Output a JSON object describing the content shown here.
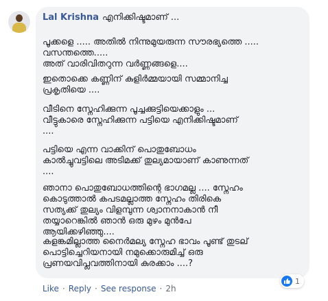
{
  "comment": {
    "author": "Lal Krishna",
    "first_line": "എനിക്കിഷ്ടമാണ് ...",
    "paragraphs": [
      [
        "പൂക്കളെ ..... അതിൽ നിന്നുമുയരുന്ന സൗരഭ്യത്തെ .....",
        "വസന്തത്തെ.....",
        "അത് വാരിവിതറുന്ന വർണ്ണങ്ങളെ...."
      ],
      [
        "ഇതൊക്കെ കണ്ണിന് കുളിർമ്മയായി സമ്മാനിച്ച",
        "പ്രകൃതിയെ ...."
      ],
      [
        "വീടിനെ സ്നേഹിക്കുന്ന പൂച്ചക്കുട്ടിയെക്കാളും ...",
        "വീട്ടുകാരെ സ്നേഹിക്കുന്ന പട്ടിയെ എനിക്കിഷ്ടമാണ്",
        "...."
      ],
      [
        "പട്ടിയെ എന്ന വാക്കിന് പൊതുബോധം",
        "കാൽച്ചുവട്ടിലെ അടിമക്ക് തുല്യമായാണ് കാണുന്നത്",
        "...."
      ],
      [
        "ഞാനാ പൊതുബോധത്തിന്റെ ഭാഗമല്ല .... സ്നേഹം",
        "കൊടുത്താൽ കപടമല്ലാത്ത സ്നേഹം തിരികെ",
        "സത്യക്ക് തുല്യം വിളമ്പുന്ന ശ്വാനനാകാൻ നീ",
        "തയ്യാറെങ്കിൽ ഞാൻ ഒരു മുഴം മുൻപേ",
        "ആയിക്കഴിഞ്ഞു...."
      ],
      [
        "കളങ്കമില്ലാത്ത നൈർമല്യ സ്നേഹ ഭാവം പൂണ്ട് തുടല്",
        "പൊട്ടിച്ചെറിയനായി നമുക്കൊരുമിച്ച് ഒരു",
        "പ്രണയവിപ്ലവത്തിനായി കുരക്കാം ....?"
      ]
    ]
  },
  "reactions": {
    "icon": "thumbs-up-icon",
    "count": "1",
    "color": "#1877f2"
  },
  "actions": {
    "like": "Like",
    "reply": "Reply",
    "see_response": "See response",
    "time": "2h"
  }
}
